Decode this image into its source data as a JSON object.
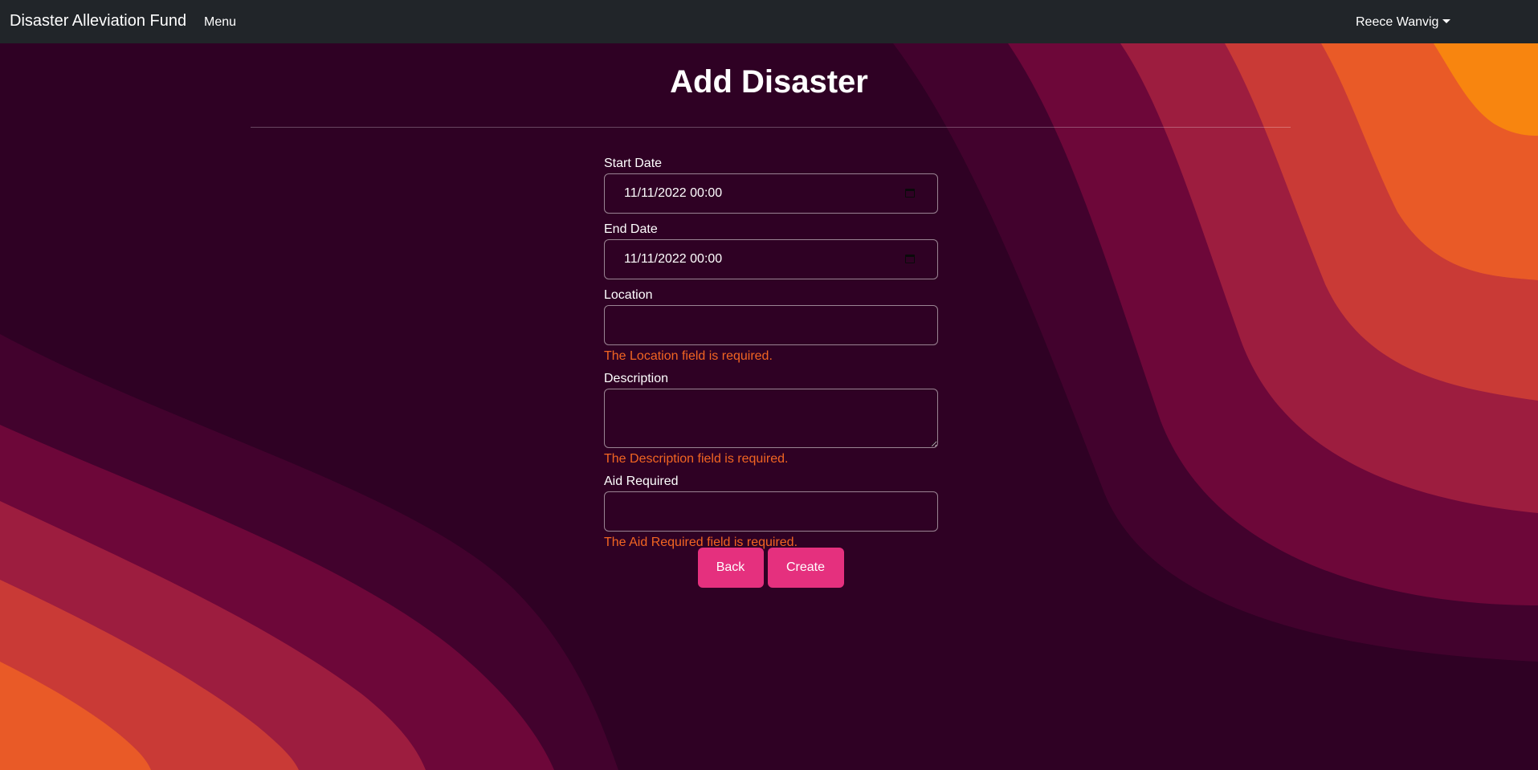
{
  "navbar": {
    "brand": "Disaster Alleviation Fund",
    "menu_label": "Menu",
    "user_name": "Reece Wanvig"
  },
  "page": {
    "title": "Add Disaster"
  },
  "form": {
    "start_date": {
      "label": "Start Date",
      "value": "11/11/2022 00:00"
    },
    "end_date": {
      "label": "End Date",
      "value": "11/11/2022 00:00"
    },
    "location": {
      "label": "Location",
      "value": "",
      "error": "The Location field is required."
    },
    "description": {
      "label": "Description",
      "value": "",
      "error": "The Description field is required."
    },
    "aid_required": {
      "label": "Aid Required",
      "value": "",
      "error": "The Aid Required field is required."
    }
  },
  "buttons": {
    "back_label": "Back",
    "create_label": "Create"
  },
  "colors": {
    "navbar_bg": "#212529",
    "page_bg": "#2f0124",
    "button_bg": "#e5307e",
    "error_text": "#f26522",
    "wave_colors": [
      "#42022d",
      "#6d0739",
      "#9d1d3f",
      "#c93a36",
      "#e95a27",
      "#f8850f"
    ]
  }
}
